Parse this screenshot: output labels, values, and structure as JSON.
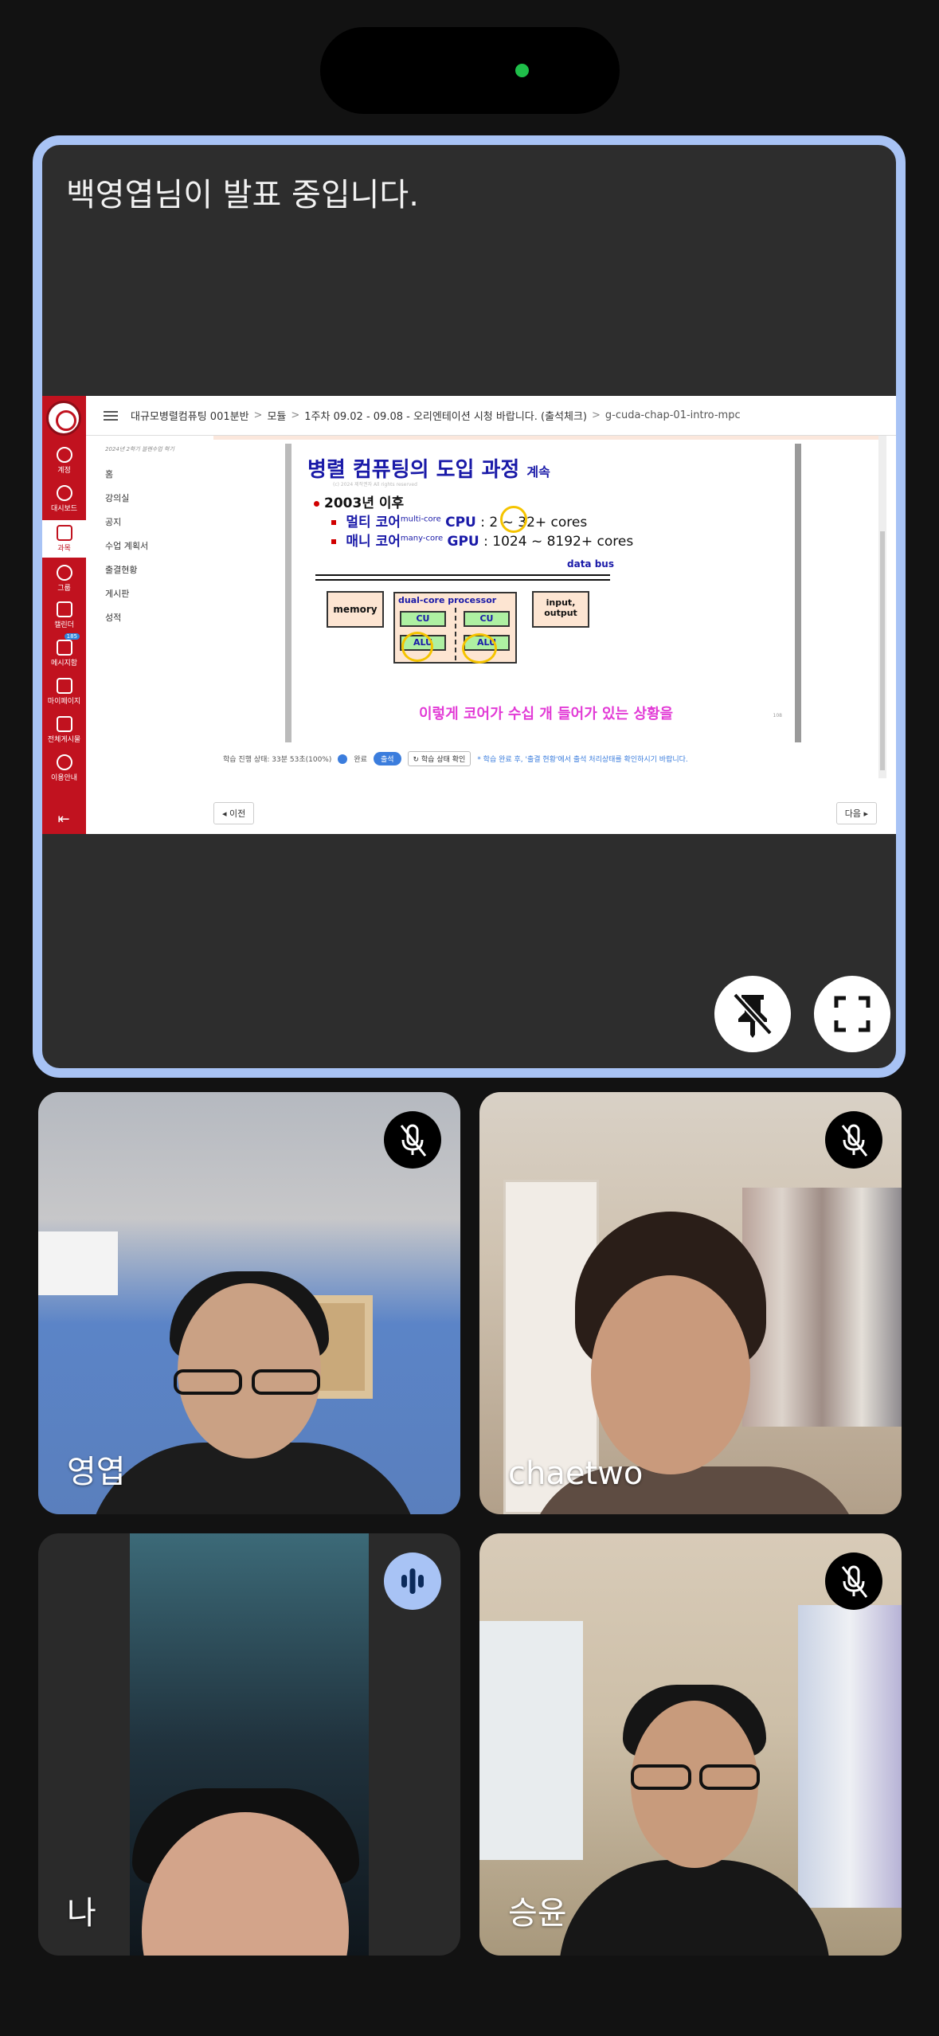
{
  "meeting": {
    "presenting_banner": "백영엽님이 발표 중입니다."
  },
  "shared_screen": {
    "breadcrumb": [
      "대규모병렬컴퓨팅 001분반",
      "모듈",
      "1주차 09.02 - 09.08 - 오리엔테이션 시청 바랍니다. (출석체크)",
      "g-cuda-chap-01-intro-mpc"
    ],
    "sidebar": [
      {
        "label": "계정",
        "icon": "account-icon"
      },
      {
        "label": "대시보드",
        "icon": "dashboard-icon"
      },
      {
        "label": "과목",
        "icon": "courses-icon"
      },
      {
        "label": "그룹",
        "icon": "groups-icon"
      },
      {
        "label": "캘린더",
        "icon": "calendar-icon"
      },
      {
        "label": "메시지함",
        "icon": "inbox-icon",
        "badge": "185"
      },
      {
        "label": "마이페이지",
        "icon": "mypage-icon"
      },
      {
        "label": "전체게시물",
        "icon": "posts-icon"
      },
      {
        "label": "이용안내",
        "icon": "help-icon"
      }
    ],
    "course_nav": {
      "term": "2024년 2학기 블렌수업 학기",
      "items": [
        "홈",
        "강의실",
        "공지",
        "수업 계획서",
        "출결현황",
        "게시판",
        "성적"
      ]
    },
    "slide": {
      "title": "병렬 컴퓨팅의 도입 과정",
      "title_suffix": "계속",
      "copyright": "(c) 2024 제작권자 All rights reserved",
      "bullet_1": "2003년 이후",
      "bullet_2": {
        "prefix": "멀티 코어",
        "sup": "multi-core",
        "label": "CPU",
        "value": ": 2 ~ 32+ cores"
      },
      "bullet_3": {
        "prefix": "매니 코어",
        "sup": "many-core",
        "label": "GPU",
        "value": ": 1024 ~ 8192+ cores"
      },
      "data_bus": "data bus",
      "memory": "memory",
      "processor": "dual-core processor",
      "cu": "CU",
      "alu": "ALU",
      "io": "input, output",
      "annotation": "이렇게 코어가 수십 개 들어가 있는 상황을",
      "page_no": "108"
    },
    "status": {
      "progress": "학습 진행 상태: 33분 53초(100%)",
      "complete": "완료",
      "attendance": "출석",
      "check_button": "학습 상태 확인",
      "note": "* 학습 완료 후, '출결 현황'에서 출석 처리상태를 확인하시기 바랍니다."
    },
    "prev_button": "◂ 이전",
    "next_button": "다음 ▸"
  },
  "controls": {
    "unpin_icon": "pin-off-icon",
    "fullscreen_icon": "fullscreen-icon"
  },
  "participants": [
    {
      "name": "영엽",
      "status": "muted"
    },
    {
      "name": "chaetwo",
      "status": "muted"
    },
    {
      "name": "나",
      "status": "speaking"
    },
    {
      "name": "승윤",
      "status": "muted"
    }
  ]
}
